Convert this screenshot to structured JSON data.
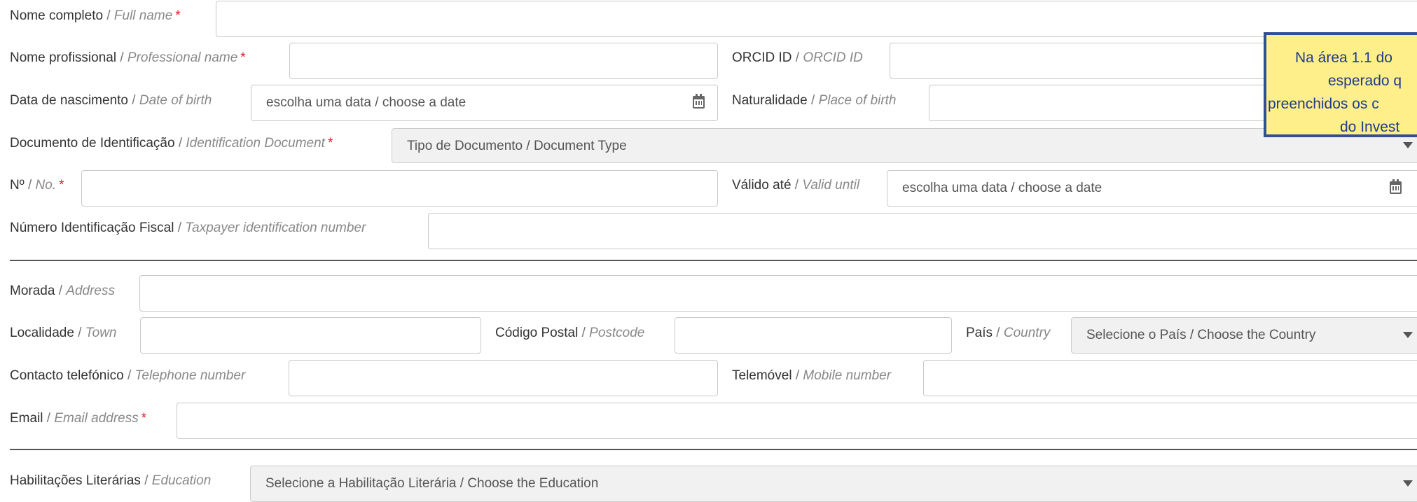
{
  "form": {
    "full_name": {
      "pt": "Nome completo",
      "sep": " / ",
      "en": "Full name",
      "req": "*"
    },
    "professional_name": {
      "pt": "Nome profissional",
      "sep": " / ",
      "en": "Professional name",
      "req": "*"
    },
    "orcid": {
      "pt": "ORCID ID",
      "sep": " / ",
      "en": "ORCID ID"
    },
    "date_of_birth": {
      "pt": "Data de nascimento",
      "sep": " / ",
      "en": "Date of birth",
      "placeholder": "escolha uma data / choose a date"
    },
    "place_of_birth": {
      "pt": "Naturalidade",
      "sep": " / ",
      "en": "Place of birth"
    },
    "id_document": {
      "pt": "Documento de Identificação",
      "sep": " / ",
      "en": "Identification Document",
      "req": "*",
      "selected": "Tipo de Documento / Document Type"
    },
    "doc_number": {
      "pt": "Nº",
      "sep": " / ",
      "en": "No.",
      "req": "*"
    },
    "valid_until": {
      "pt": "Válido até",
      "sep": " / ",
      "en": "Valid until",
      "placeholder": "escolha uma data / choose a date"
    },
    "tax_id": {
      "pt": "Número Identificação Fiscal",
      "sep": " / ",
      "en": "Taxpayer identification number"
    },
    "address": {
      "pt": "Morada",
      "sep": " / ",
      "en": "Address"
    },
    "town": {
      "pt": "Localidade",
      "sep": " / ",
      "en": "Town"
    },
    "postcode": {
      "pt": "Código Postal",
      "sep": " / ",
      "en": "Postcode"
    },
    "country": {
      "pt": "País",
      "sep": " / ",
      "en": "Country",
      "selected": "Selecione o País / Choose the Country"
    },
    "telephone": {
      "pt": "Contacto telefónico",
      "sep": " / ",
      "en": "Telephone number"
    },
    "mobile": {
      "pt": "Telemóvel",
      "sep": " / ",
      "en": "Mobile number"
    },
    "email": {
      "pt": "Email",
      "sep": " / ",
      "en": "Email address",
      "req": "*"
    },
    "education": {
      "pt": "Habilitações Literárias",
      "sep": " / ",
      "en": "Education",
      "selected": "Selecione a Habilitação Literária / Choose the Education"
    }
  },
  "annotation": {
    "lines": [
      "Na área 1.1 do",
      "esperado q",
      "preenchidos os c",
      "do Invest"
    ],
    "background": "#ffef8a",
    "border_color": "#2f4f9b"
  },
  "icons": {
    "calendar": "calendar-icon",
    "dropdown": "chevron-down-icon"
  }
}
